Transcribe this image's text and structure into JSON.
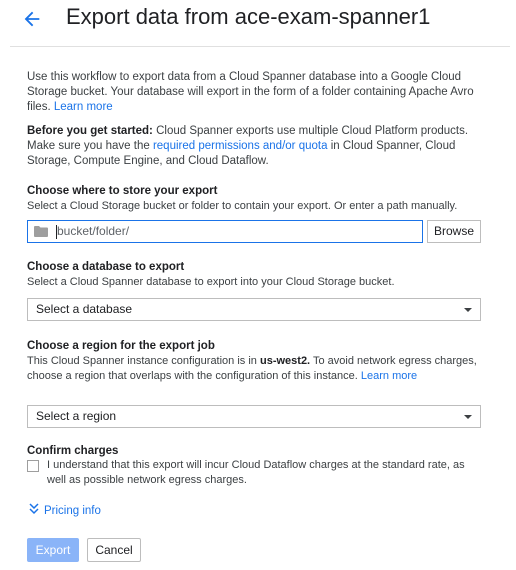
{
  "header": {
    "title": "Export data from ace-exam-spanner1",
    "back_icon": "arrow-back-icon"
  },
  "intro": {
    "text": "Use this workflow to export data from a Cloud Spanner database into a Google Cloud Storage bucket. Your database will export in the form of a folder containing Apache Avro files.",
    "learn_more": "Learn more"
  },
  "before_start": {
    "label": "Before you get started:",
    "text_before": "Cloud Spanner exports use multiple Cloud Platform products. Make sure you have the",
    "link": "required permissions and/or quota",
    "text_after": "in Cloud Spanner, Cloud Storage, Compute Engine, and Cloud Dataflow."
  },
  "storage": {
    "title": "Choose where to store your export",
    "description": "Select a Cloud Storage bucket or folder to contain your export. Or enter a path manually.",
    "placeholder": "bucket/folder/",
    "browse_label": "Browse",
    "folder_icon": "folder-icon"
  },
  "database": {
    "title": "Choose a database to export",
    "description": "Select a Cloud Spanner database to export into your Cloud Storage bucket.",
    "select_label": "Select a database"
  },
  "region": {
    "title": "Choose a region for the export job",
    "desc_before": "This Cloud Spanner instance configuration is in",
    "config_name": "us-west2.",
    "desc_after": "To avoid network egress charges, choose a region that overlaps with the configuration of this instance.",
    "learn_more": "Learn more",
    "select_label": "Select a region"
  },
  "charges": {
    "title": "Confirm charges",
    "checkbox_text": "I understand that this export will incur Cloud Dataflow charges at the standard rate, as well as possible network egress charges."
  },
  "pricing": {
    "label": "Pricing info",
    "icon": "chevron-double-down-icon"
  },
  "actions": {
    "export_label": "Export",
    "cancel_label": "Cancel"
  },
  "colors": {
    "link": "#1a73e8",
    "export_button_disabled": "#8ab4f8",
    "input_focus_border": "#1a73e8"
  }
}
